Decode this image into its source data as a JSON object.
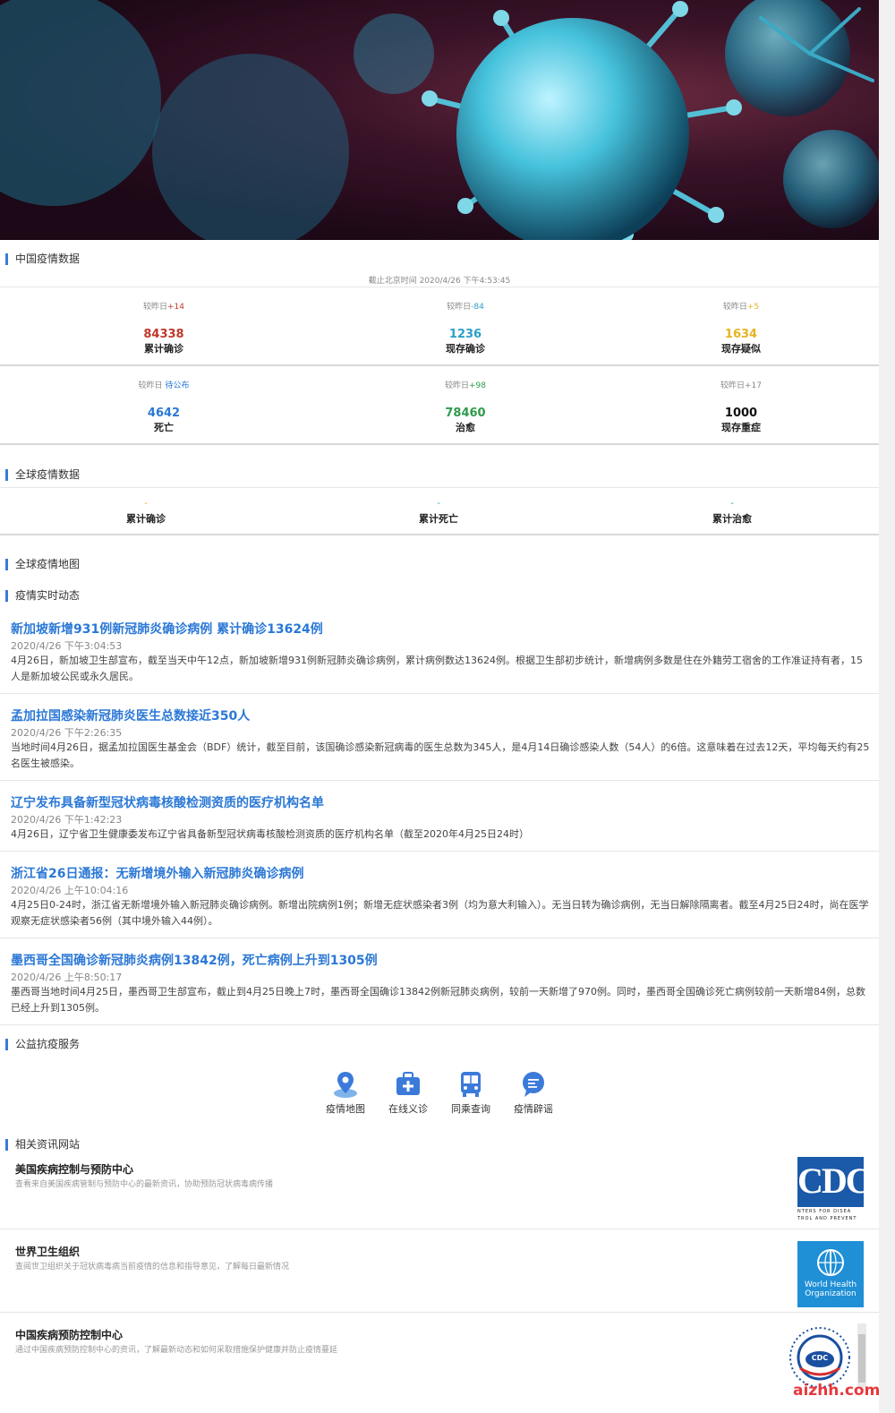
{
  "colors": {
    "accent": "#2b78d6",
    "red": "#c0392b",
    "teal": "#2a9fc9",
    "yellow": "#e6b422",
    "blue": "#2b78d6",
    "green": "#2e9a4b",
    "dark": "#111111"
  },
  "china": {
    "section_title": "中国疫情数据",
    "timestamp": "截止北京时间 2020/4/26 下午4:53:45",
    "stats": [
      {
        "cmp_label": "较昨日",
        "cmp_value": "+14",
        "value": "84338",
        "label": "累计确诊"
      },
      {
        "cmp_label": "较昨日",
        "cmp_value": "-84",
        "value": "1236",
        "label": "现存确诊"
      },
      {
        "cmp_label": "较昨日",
        "cmp_value": "+5",
        "value": "1634",
        "label": "现存疑似"
      },
      {
        "cmp_label": "较昨日",
        "cmp_value": "待公布",
        "value": "4642",
        "label": "死亡"
      },
      {
        "cmp_label": "较昨日",
        "cmp_value": "+98",
        "value": "78460",
        "label": "治愈"
      },
      {
        "cmp_label": "较昨日",
        "cmp_value": "+17",
        "value": "1000",
        "label": "现存重症"
      }
    ]
  },
  "global": {
    "section_title": "全球疫情数据",
    "stats": [
      {
        "value": "-",
        "label": "累计确诊"
      },
      {
        "value": "-",
        "label": "累计死亡"
      },
      {
        "value": "-",
        "label": "累计治愈"
      }
    ]
  },
  "map": {
    "section_title": "全球疫情地图"
  },
  "news": {
    "section_title": "疫情实时动态",
    "items": [
      {
        "title": "新加坡新增931例新冠肺炎确诊病例 累计确诊13624例",
        "date": "2020/4/26 下午3:04:53",
        "body": "4月26日，新加坡卫生部宣布，截至当天中午12点，新加坡新增931例新冠肺炎确诊病例，累计病例数达13624例。根据卫生部初步统计，新增病例多数是住在外籍劳工宿舍的工作准证持有者，15人是新加坡公民或永久居民。"
      },
      {
        "title": "孟加拉国感染新冠肺炎医生总数接近350人",
        "date": "2020/4/26 下午2:26:35",
        "body": "当地时间4月26日，据孟加拉国医生基金会（BDF）统计，截至目前，该国确诊感染新冠病毒的医生总数为345人，是4月14日确诊感染人数（54人）的6倍。这意味着在过去12天，平均每天约有25名医生被感染。"
      },
      {
        "title": "辽宁发布具备新型冠状病毒核酸检测资质的医疗机构名单",
        "date": "2020/4/26 下午1:42:23",
        "body": "4月26日，辽宁省卫生健康委发布辽宁省具备新型冠状病毒核酸检测资质的医疗机构名单（截至2020年4月25日24时）"
      },
      {
        "title": "浙江省26日通报：无新增境外输入新冠肺炎确诊病例",
        "date": "2020/4/26 上午10:04:16",
        "body": "4月25日0-24时，浙江省无新增境外输入新冠肺炎确诊病例。新增出院病例1例；新增无症状感染者3例（均为意大利输入）。无当日转为确诊病例，无当日解除隔离者。截至4月25日24时，尚在医学观察无症状感染者56例（其中境外输入44例）。"
      },
      {
        "title": "墨西哥全国确诊新冠肺炎病例13842例，死亡病例上升到1305例",
        "date": "2020/4/26 上午8:50:17",
        "body": "墨西哥当地时间4月25日，墨西哥卫生部宣布，截止到4月25日晚上7时，墨西哥全国确诊13842例新冠肺炎病例，较前一天新增了970例。同时，墨西哥全国确诊死亡病例较前一天新增84例，总数已经上升到1305例。"
      }
    ]
  },
  "services": {
    "section_title": "公益抗疫服务",
    "items": [
      {
        "label": "疫情地图",
        "icon": "map-pin-icon"
      },
      {
        "label": "在线义诊",
        "icon": "medical-kit-icon"
      },
      {
        "label": "同乘查询",
        "icon": "bus-icon"
      },
      {
        "label": "疫情辟谣",
        "icon": "rumor-chat-icon"
      }
    ]
  },
  "related": {
    "section_title": "相关资讯网站",
    "items": [
      {
        "title": "美国疾病控制与预防中心",
        "desc": "查看来自美国疾病管制与预防中心的最新资讯，协助预防冠状病毒病传播",
        "logo_text": "CDC",
        "logo_sub1": "NTERS FOR DISEA",
        "logo_sub2": "TROL AND PREVENT"
      },
      {
        "title": "世界卫生组织",
        "desc": "查阅世卫组织关于冠状病毒病当前疫情的信息和指导意见，了解每日最新情况",
        "logo_text": "World Health",
        "logo_sub1": "Organization"
      },
      {
        "title": "中国疾病预防控制中心",
        "desc": "通过中国疾病预防控制中心的资讯，了解最新动态和如何采取措施保护健康并防止疫情蔓延",
        "logo_text": "CDC"
      }
    ]
  },
  "watermark": "aizhh.com"
}
